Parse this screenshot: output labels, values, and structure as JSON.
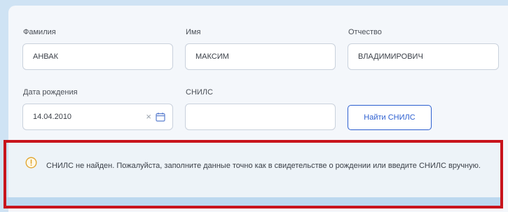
{
  "form": {
    "surname": {
      "label": "Фамилия",
      "value": "АНВАК"
    },
    "name": {
      "label": "Имя",
      "value": "МАКСИМ"
    },
    "patronymic": {
      "label": "Отчество",
      "value": "ВЛАДИМИРОВИЧ"
    },
    "birth_date": {
      "label": "Дата рождения",
      "value": "14.04.2010"
    },
    "snils": {
      "label": "СНИЛС",
      "value": ""
    },
    "find_button_label": "Найти СНИЛС"
  },
  "alert": {
    "message": "СНИЛС не найден. Пожалуйста, заполните данные точно как в свидетельстве о рождении или введите СНИЛС вручную.",
    "icon": "warning-circle-icon",
    "highlight_color": "#c8141c"
  },
  "colors": {
    "accent": "#2c5fd0",
    "background": "#d3e6f5"
  }
}
